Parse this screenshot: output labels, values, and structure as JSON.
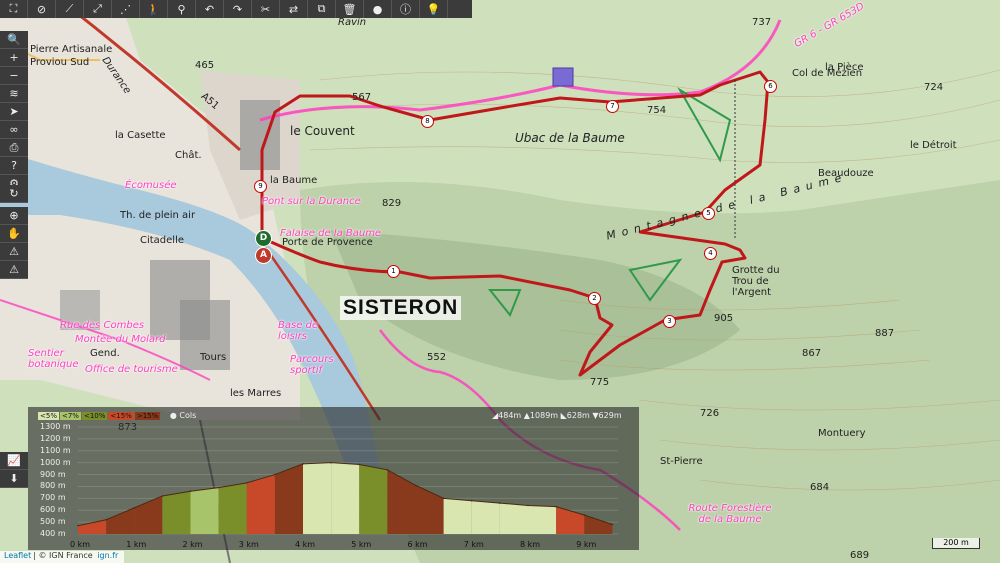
{
  "toolbar_top": {
    "buttons": [
      {
        "icon": "fullscreen-icon",
        "glyph": "⛶"
      },
      {
        "icon": "eye-off-icon",
        "glyph": "⊘"
      },
      {
        "icon": "draw-line-icon",
        "glyph": "⟋"
      },
      {
        "icon": "draw-route-icon",
        "glyph": "⤢"
      },
      {
        "icon": "nodes-icon",
        "glyph": "⋰"
      },
      {
        "icon": "hiker-icon",
        "glyph": "🚶"
      },
      {
        "icon": "bike-icon",
        "glyph": "⚲"
      },
      {
        "icon": "undo-icon",
        "glyph": "↶"
      },
      {
        "icon": "redo-icon",
        "glyph": "↷"
      },
      {
        "icon": "scissors-icon",
        "glyph": "✂"
      },
      {
        "icon": "reverse-icon",
        "glyph": "⇄"
      },
      {
        "icon": "copy-icon",
        "glyph": "⧉"
      },
      {
        "icon": "delete-icon",
        "glyph": "🗑"
      },
      {
        "icon": "marker-icon",
        "glyph": "●"
      },
      {
        "icon": "info-icon",
        "glyph": "ⓘ"
      },
      {
        "icon": "lightbulb-icon",
        "glyph": "💡"
      }
    ]
  },
  "toolbar_left": {
    "group1": [
      {
        "icon": "search-icon",
        "glyph": "🔍"
      },
      {
        "icon": "zoom-in-icon",
        "glyph": "+"
      },
      {
        "icon": "zoom-out-icon",
        "glyph": "−"
      },
      {
        "icon": "layers-icon",
        "glyph": "≋"
      },
      {
        "icon": "locate-arrow-icon",
        "glyph": "➤"
      },
      {
        "icon": "link-icon",
        "glyph": "∞"
      },
      {
        "icon": "print-icon",
        "glyph": "⎙"
      },
      {
        "icon": "help-icon",
        "glyph": "?"
      },
      {
        "icon": "settings-icon",
        "glyph": "⚙"
      }
    ],
    "group2": [
      {
        "icon": "refresh-icon",
        "glyph": "↻"
      }
    ],
    "group3": [
      {
        "icon": "crosshair-icon",
        "glyph": "⊕"
      },
      {
        "icon": "hand-icon",
        "glyph": "✋"
      },
      {
        "icon": "warning-icon",
        "glyph": "⚠"
      },
      {
        "icon": "alert-icon",
        "glyph": "⚠"
      }
    ],
    "elevation": [
      {
        "icon": "elevation-chart-icon",
        "glyph": "📈"
      },
      {
        "icon": "download-icon",
        "glyph": "⬇"
      }
    ]
  },
  "map": {
    "town_label": "SISTERON",
    "labels": {
      "pierre_proviou": "Pierre Artisanale",
      "proviou_sud": "Proviou Sud",
      "la_casette": "la Casette",
      "le_couvent": "le Couvent",
      "la_baume": "la Baume",
      "ubac": "Ubac de la Baume",
      "montagne": "Montagne de la Baume",
      "col_de_mezien": "Col de Mézien",
      "la_piece": "la Pièce",
      "le_detroit": "le Détroit",
      "beaudouze": "Beaudouze",
      "grotte": "Grotte du Trou de l'Argent",
      "porte_provence": "Porte de Provence",
      "plein_air": "Th. de plein air",
      "citadelle": "Citadelle",
      "montuery": "Montuery",
      "st_pierre": "St-Pierre",
      "les_marres": "les Marres",
      "ravin": "Ravin",
      "chat": "Chât.",
      "a51": "A51",
      "durance": "Durance",
      "gend": "Gend.",
      "tours": "Tours"
    },
    "pink_labels": {
      "ecomusee": "Écomusée",
      "pont_durance": "Pont sur la Durance",
      "falaise": "Falaise de la Baume",
      "base_loisirs": "Base de loisirs",
      "parcours": "Parcours sportif",
      "rue_combes": "Rue des Combes",
      "montee_molard": "Montée du Molard",
      "office": "Office de tourisme",
      "sentier": "Sentier botanique",
      "route_forestiere": "Route Forestière de la Baume",
      "gr_label": "GR 6 - GR 653D"
    },
    "altitudes": [
      "737",
      "465",
      "567",
      "754",
      "724",
      "829",
      "905",
      "887",
      "867",
      "775",
      "726",
      "552",
      "684",
      "873",
      "689"
    ],
    "waypoints": [
      "1",
      "2",
      "3",
      "4",
      "5",
      "6",
      "7",
      "8",
      "9"
    ],
    "start_marker": "D",
    "end_marker": "A",
    "route_color": "#c0171b",
    "gr_color": "#ff3fbf"
  },
  "elevation_panel": {
    "slope_legend": [
      "<5%",
      "<7%",
      "<10%",
      "<15%",
      ">15%"
    ],
    "slope_colors": [
      "#d9e6b0",
      "#a8c46a",
      "#7a8f2a",
      "#c8492a",
      "#8a3a1c"
    ],
    "cols_label": "Cols",
    "stats": {
      "ascent": "484m",
      "max": "1089m",
      "descent": "628m",
      "min": "629m"
    },
    "y_labels": [
      "1300 m",
      "1200 m",
      "1100 m",
      "1000 m",
      "900 m",
      "800 m",
      "700 m",
      "600 m",
      "500 m",
      "400 m"
    ],
    "x_labels": [
      "0 km",
      "1 km",
      "2 km",
      "3 km",
      "4 km",
      "5 km",
      "6 km",
      "7 km",
      "8 km",
      "9 km"
    ]
  },
  "chart_data": {
    "type": "area",
    "x": [
      0,
      0.5,
      1.0,
      1.5,
      2.0,
      2.5,
      3.0,
      3.5,
      4.0,
      4.5,
      5.0,
      5.5,
      6.0,
      6.5,
      7.0,
      7.5,
      8.0,
      8.5,
      9.0,
      9.5
    ],
    "series": [
      {
        "values": [
          470,
          520,
          620,
          720,
          760,
          790,
          830,
          900,
          990,
          1000,
          985,
          940,
          810,
          700,
          680,
          660,
          640,
          630,
          560,
          480
        ]
      }
    ],
    "xlabel": "",
    "ylabel": "",
    "ylim": [
      400,
      1300
    ],
    "xlim": [
      0,
      9.6
    ]
  },
  "footer": {
    "leaflet": "Leaflet",
    "ign": "© IGN France",
    "ign_url": "ign.fr",
    "scale": "200 m"
  }
}
